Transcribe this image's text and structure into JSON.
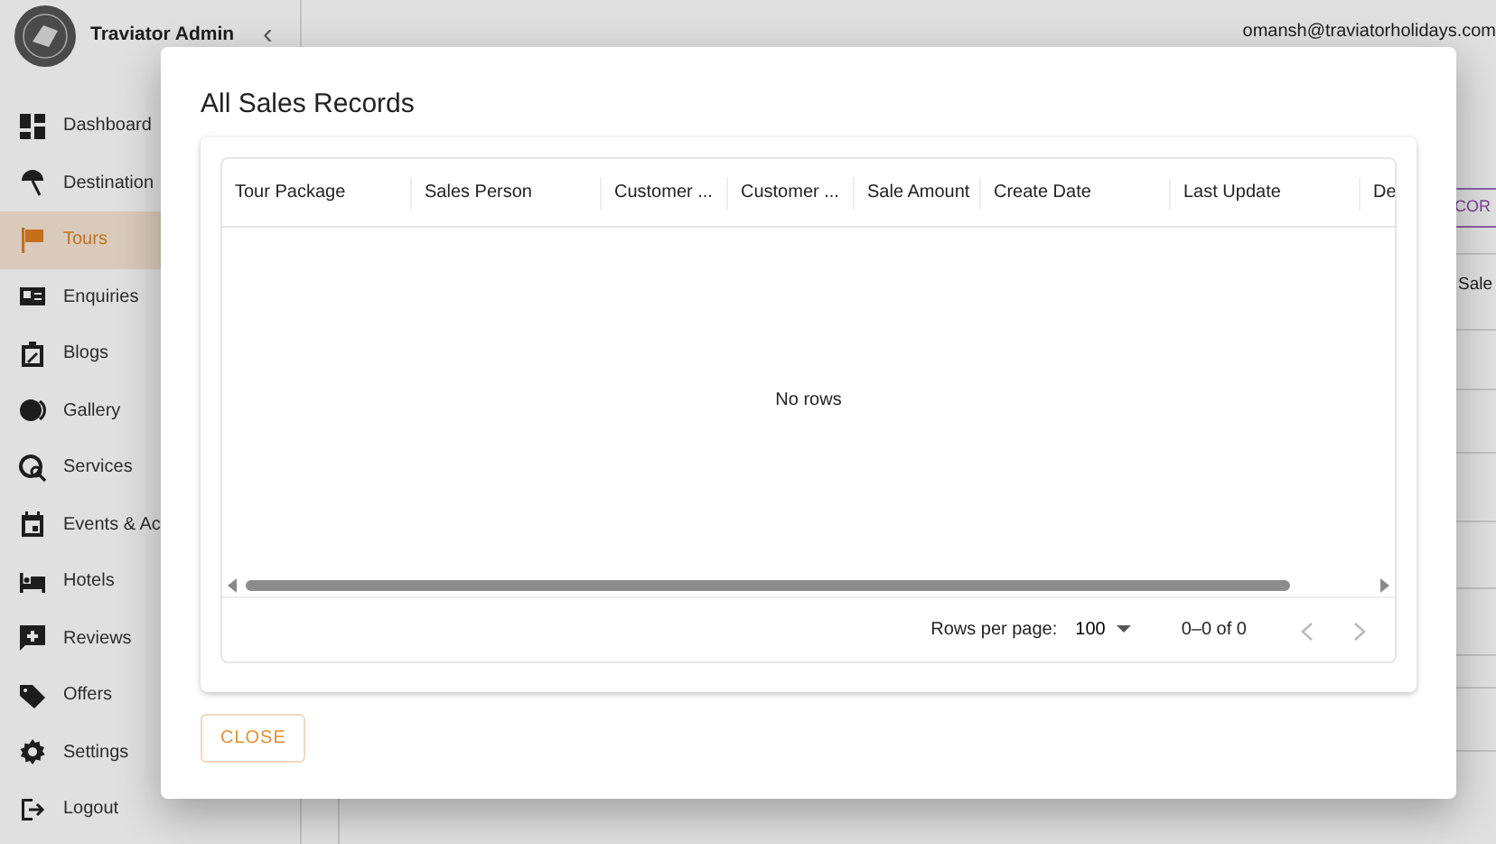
{
  "sidebar": {
    "brand": "Traviator Admin",
    "collapse": "‹",
    "items": [
      {
        "label": "Dashboard",
        "selected": false
      },
      {
        "label": "Destination",
        "selected": false
      },
      {
        "label": "Tours",
        "selected": true
      },
      {
        "label": "Enquiries",
        "selected": false
      },
      {
        "label": "Blogs",
        "selected": false
      },
      {
        "label": "Gallery",
        "selected": false
      },
      {
        "label": "Services",
        "selected": false
      },
      {
        "label": "Events & Ac",
        "selected": false
      },
      {
        "label": "Hotels",
        "selected": false
      },
      {
        "label": "Reviews",
        "selected": false
      },
      {
        "label": "Offers",
        "selected": false
      },
      {
        "label": "Settings",
        "selected": false
      },
      {
        "label": "Logout",
        "selected": false
      }
    ]
  },
  "topbar": {
    "user": "omansh@traviatorholidays.com"
  },
  "background": {
    "button": "COR",
    "column": "Sale"
  },
  "dialog": {
    "title": "All Sales Records",
    "columns": [
      "Tour Package",
      "Sales Person",
      "Customer ...",
      "Customer ...",
      "Sale Amount",
      "Create Date",
      "Last Update",
      "De"
    ],
    "empty": "No rows",
    "footer": {
      "rows_label": "Rows per page:",
      "rows_value": "100",
      "range": "0–0 of 0"
    },
    "close": "CLOSE"
  }
}
